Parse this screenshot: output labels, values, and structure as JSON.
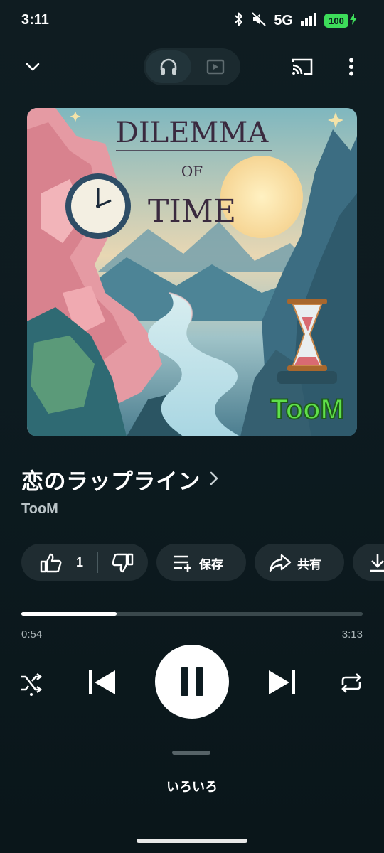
{
  "status_bar": {
    "time": "3:11",
    "network": "5G",
    "battery": "100"
  },
  "top_bar": {
    "mode_options": [
      "audio",
      "video"
    ],
    "active_mode": "audio"
  },
  "album_art": {
    "title_line1": "DILEMMA",
    "title_line2": "OF",
    "title_line3": "TIME",
    "logo_text": "TooM"
  },
  "song": {
    "title": "恋のラップライン",
    "artist": "TooM"
  },
  "actions": {
    "like_count": "1",
    "save_label": "保存",
    "share_label": "共有"
  },
  "playback": {
    "elapsed": "0:54",
    "total": "3:13",
    "progress_fraction": 0.2798,
    "state": "playing"
  },
  "up_next": {
    "label": "いろいろ"
  },
  "colors": {
    "background": "#0f1c21",
    "chip_bg": "#1f2c31",
    "battery": "#3ddc5a",
    "track": "#3a484c",
    "logo_green": "#5fe04a"
  }
}
